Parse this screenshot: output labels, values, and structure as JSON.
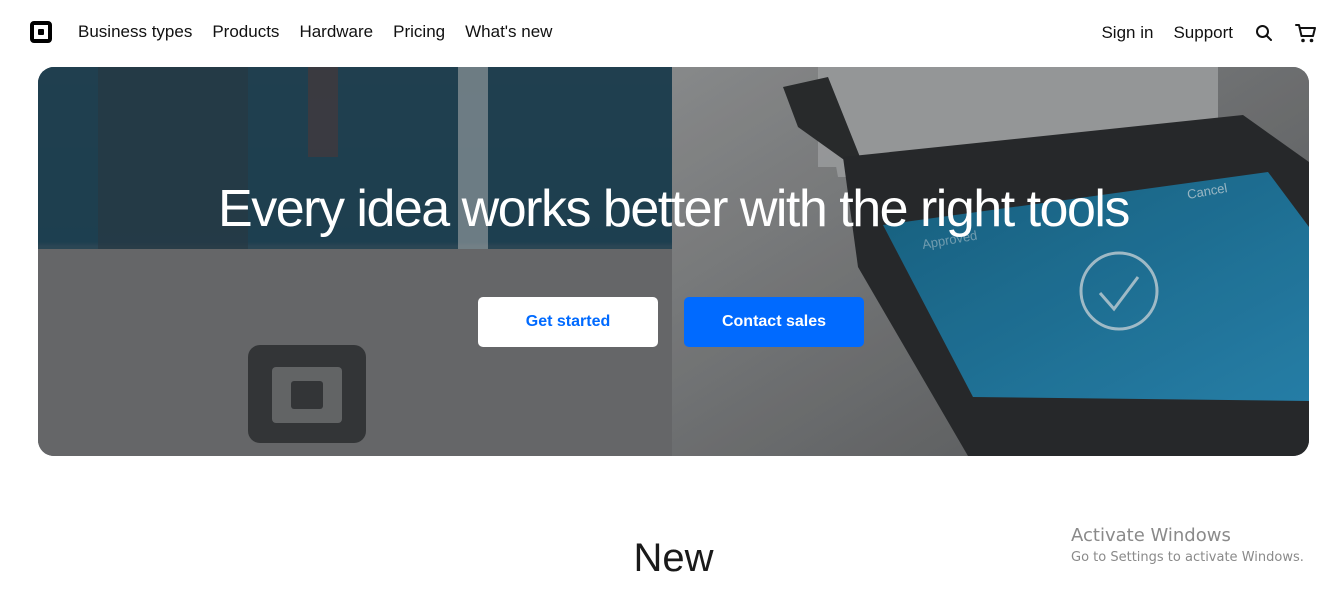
{
  "nav": {
    "logo_icon": "square-logo-icon",
    "links": [
      "Business types",
      "Products",
      "Hardware",
      "Pricing",
      "What's new"
    ],
    "sign_in": "Sign in",
    "support": "Support",
    "search_icon": "search-icon",
    "cart_icon": "cart-icon"
  },
  "hero": {
    "title": "Every idea works better with the right tools",
    "get_started": "Get started",
    "contact_sales": "Contact sales",
    "terminal_cancel": "Cancel",
    "terminal_approved": "Approved"
  },
  "section": {
    "title": "New"
  },
  "watermark": {
    "line1": "Activate Windows",
    "line2": "Go to Settings to activate Windows."
  },
  "colors": {
    "accent": "#006aff",
    "hero_text": "#ffffff"
  }
}
